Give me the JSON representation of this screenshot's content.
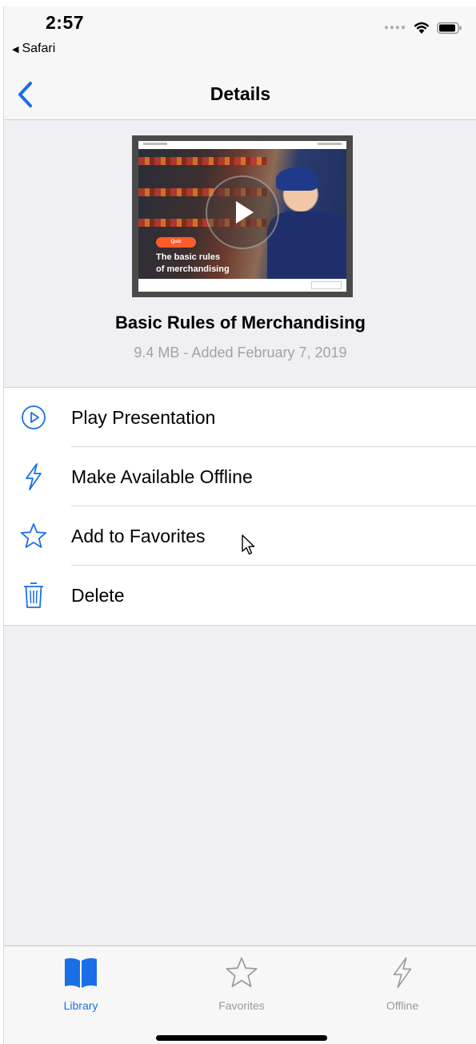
{
  "status_bar": {
    "time": "2:57",
    "back_app": "Safari",
    "back_arrow": "◀"
  },
  "navbar": {
    "title": "Details",
    "back_icon": "chevron-left-icon"
  },
  "presentation": {
    "thumbnail": {
      "badge": "Quiz",
      "caption_line1": "The basic rules",
      "caption_line2": "of merchandising"
    },
    "title": "Basic Rules of Merchandising",
    "meta": "9.4 MB - Added February 7, 2019"
  },
  "actions": [
    {
      "label": "Play Presentation",
      "icon": "play-circle-icon"
    },
    {
      "label": "Make Available Offline",
      "icon": "bolt-icon"
    },
    {
      "label": "Add to Favorites",
      "icon": "star-icon"
    },
    {
      "label": "Delete",
      "icon": "trash-icon"
    }
  ],
  "tabs": [
    {
      "label": "Library",
      "icon": "book-icon",
      "active": true
    },
    {
      "label": "Favorites",
      "icon": "star-icon",
      "active": false
    },
    {
      "label": "Offline",
      "icon": "bolt-icon",
      "active": false
    }
  ],
  "colors": {
    "accent": "#1a6fe8",
    "secondary_text": "#a2a2a7",
    "inactive_tab": "#9a9a9e",
    "background": "#efeff4"
  }
}
